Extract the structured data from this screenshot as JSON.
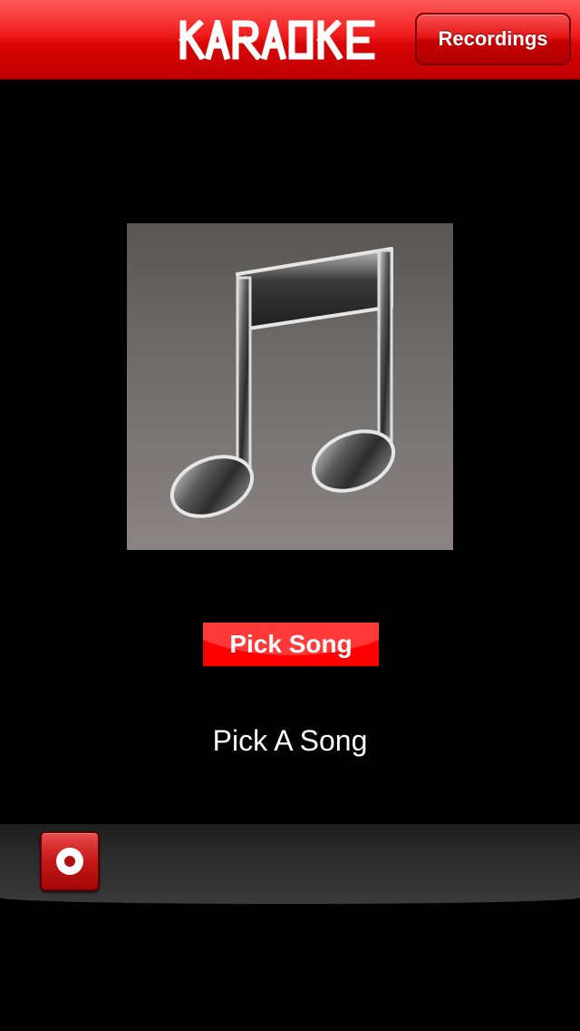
{
  "header": {
    "logo_text": "KARAOKE",
    "recordings_label": "Recordings"
  },
  "main": {
    "artwork_icon": "music-note-icon",
    "pick_song_label": "Pick Song",
    "status_text": "Pick A Song"
  },
  "toolbar": {
    "record_icon": "record-icon"
  },
  "colors": {
    "accent": "#ff0000",
    "background": "#000000",
    "toolbar": "#2c2c2c"
  }
}
